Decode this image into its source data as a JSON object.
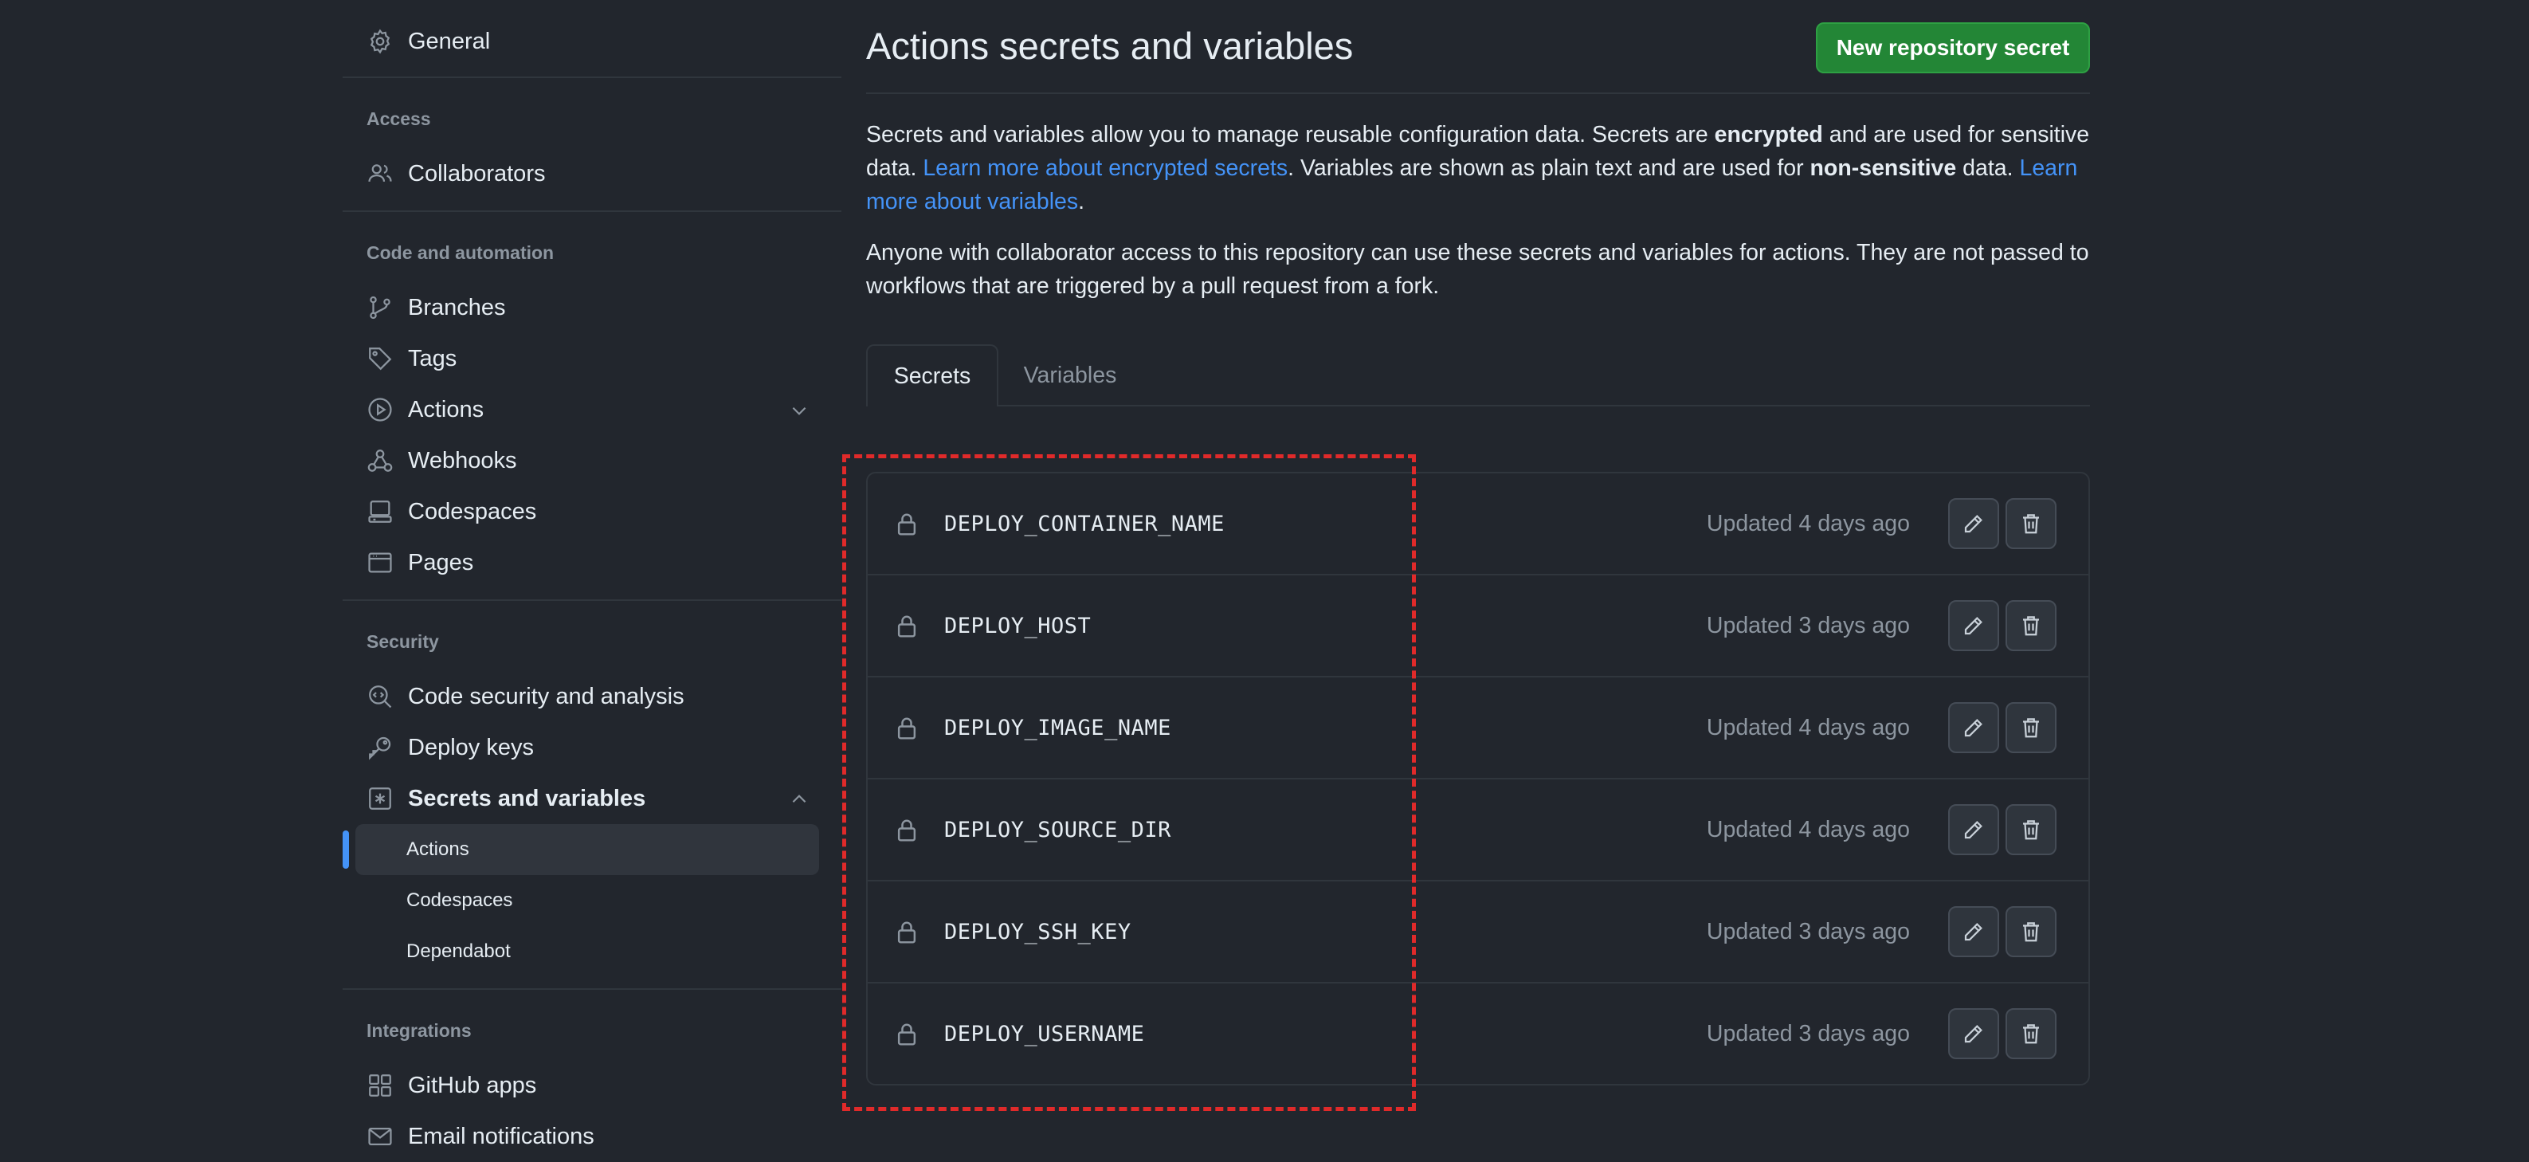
{
  "sidebar": {
    "general": "General",
    "access_title": "Access",
    "collaborators": "Collaborators",
    "code_title": "Code and automation",
    "branches": "Branches",
    "tags": "Tags",
    "actions": "Actions",
    "webhooks": "Webhooks",
    "codespaces": "Codespaces",
    "pages": "Pages",
    "security_title": "Security",
    "code_security": "Code security and analysis",
    "deploy_keys": "Deploy keys",
    "secrets_vars": "Secrets and variables",
    "sub_actions": "Actions",
    "sub_codespaces": "Codespaces",
    "sub_dependabot": "Dependabot",
    "integrations_title": "Integrations",
    "github_apps": "GitHub apps",
    "email_notifications": "Email notifications"
  },
  "main": {
    "title": "Actions secrets and variables",
    "new_secret_button": "New repository secret",
    "desc1_a": "Secrets and variables allow you to manage reusable configuration data. Secrets are ",
    "desc1_b": "encrypted",
    "desc1_c": " and are used for sensitive data. ",
    "desc1_link1": "Learn more about encrypted secrets",
    "desc1_d": ". Variables are shown as plain text and are used for ",
    "desc1_e": "non-sensitive",
    "desc1_f": " data. ",
    "desc1_link2": "Learn more about variables",
    "desc1_g": ".",
    "desc2": "Anyone with collaborator access to this repository can use these secrets and variables for actions. They are not passed to workflows that are triggered by a pull request from a fork.",
    "tabs": [
      "Secrets",
      "Variables"
    ],
    "secrets": [
      {
        "name": "DEPLOY_CONTAINER_NAME",
        "updated": "Updated 4 days ago"
      },
      {
        "name": "DEPLOY_HOST",
        "updated": "Updated 3 days ago"
      },
      {
        "name": "DEPLOY_IMAGE_NAME",
        "updated": "Updated 4 days ago"
      },
      {
        "name": "DEPLOY_SOURCE_DIR",
        "updated": "Updated 4 days ago"
      },
      {
        "name": "DEPLOY_SSH_KEY",
        "updated": "Updated 3 days ago"
      },
      {
        "name": "DEPLOY_USERNAME",
        "updated": "Updated 3 days ago"
      }
    ]
  },
  "colors": {
    "background": "#22262d",
    "primary_button": "#238636",
    "link": "#4493f8",
    "highlight": "#e02a2a",
    "muted": "#8d96a0"
  },
  "icons": [
    "gear-icon",
    "people-icon",
    "branch-icon",
    "tag-icon",
    "play-icon",
    "webhook-icon",
    "codespaces-icon",
    "browser-icon",
    "codescan-icon",
    "key-icon",
    "asterisk-icon",
    "apps-icon",
    "mail-icon",
    "lock-icon",
    "pencil-icon",
    "trash-icon",
    "chevron-down-icon",
    "chevron-up-icon"
  ]
}
